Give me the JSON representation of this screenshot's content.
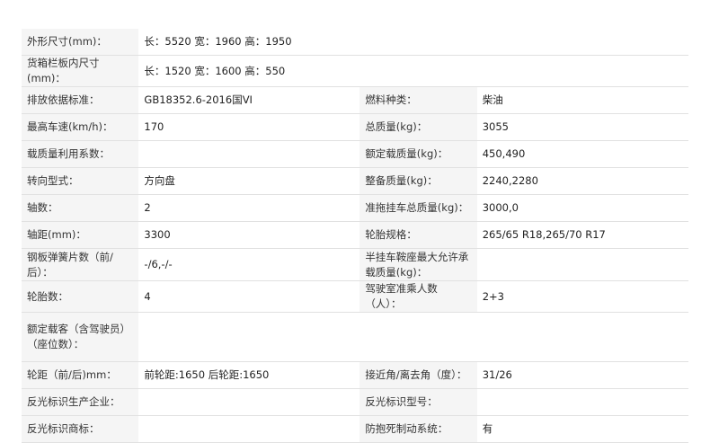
{
  "rows": [
    {
      "label": "外形尺寸(mm)：",
      "value": "长：5520 宽：1960 高：1950",
      "full": true
    },
    {
      "label": "货箱栏板内尺寸(mm)：",
      "value": "长：1520 宽：1600 高：550",
      "full": true
    },
    {
      "label": "排放依据标准：",
      "value": "GB18352.6-2016国VI",
      "label2": "燃料种类：",
      "value2": "柴油"
    },
    {
      "label": "最高车速(km/h)：",
      "value": "170",
      "label2": "总质量(kg)：",
      "value2": "3055"
    },
    {
      "label": "载质量利用系数：",
      "value": "",
      "label2": "额定载质量(kg)：",
      "value2": "450,490"
    },
    {
      "label": "转向型式：",
      "value": "方向盘",
      "label2": "整备质量(kg)：",
      "value2": "2240,2280"
    },
    {
      "label": "轴数：",
      "value": "2",
      "label2": "准拖挂车总质量(kg)：",
      "value2": "3000,0"
    },
    {
      "label": "轴距(mm)：",
      "value": "3300",
      "label2": "轮胎规格：",
      "value2": "265/65 R18,265/70 R17"
    },
    {
      "label": "钢板弹簧片数（前/后）：",
      "value": "-/6,-/-",
      "label2": "半挂车鞍座最大允许承载质量(kg)：",
      "value2": ""
    },
    {
      "label": "轮胎数：",
      "value": "4",
      "label2": "驾驶室准乘人数（人）：",
      "value2": "2+3"
    },
    {
      "label": "额定载客（含驾驶员）（座位数）：",
      "value": "",
      "full": true
    },
    {
      "label": "轮距（前/后)mm：",
      "value": "前轮距:1650 后轮距:1650",
      "label2": "接近角/离去角（度）：",
      "value2": "31/26"
    },
    {
      "label": "反光标识生产企业：",
      "value": "",
      "label2": "反光标识型号：",
      "value2": ""
    },
    {
      "label": "反光标识商标：",
      "value": "",
      "label2": "防抱死制动系统：",
      "value2": "有"
    }
  ]
}
